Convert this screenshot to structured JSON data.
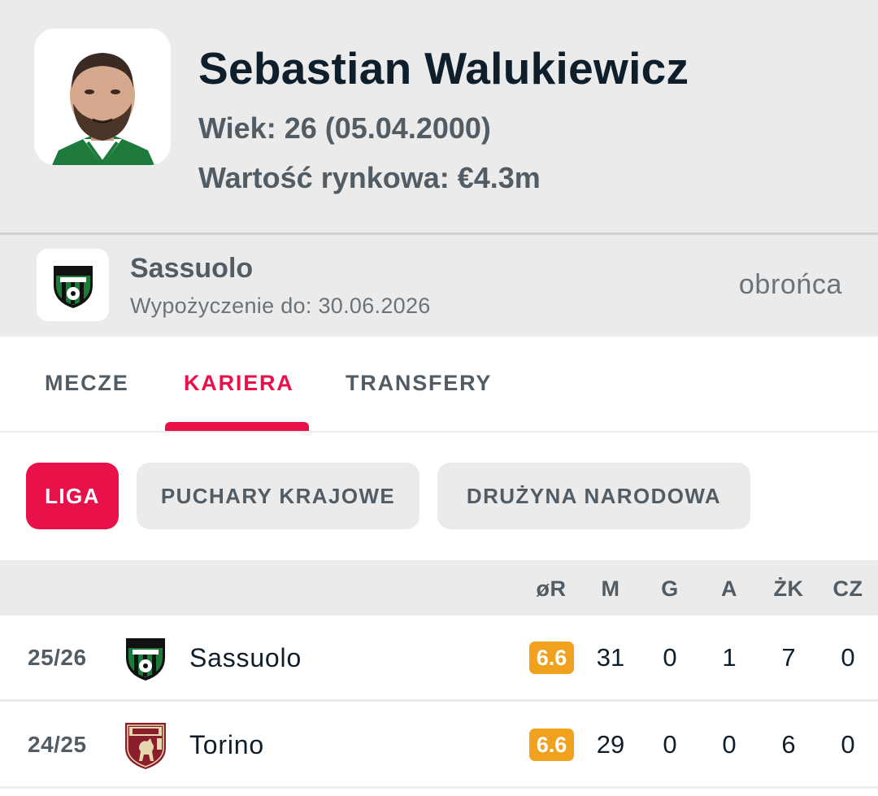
{
  "player": {
    "name": "Sebastian Walukiewicz",
    "age_line": "Wiek: 26 (05.04.2000)",
    "value_line": "Wartość rynkowa: €4.3m"
  },
  "club": {
    "name": "Sassuolo",
    "loan": "Wypożyczenie do: 30.06.2026",
    "position": "obrońca"
  },
  "tabs": [
    {
      "label": "MECZE",
      "active": false
    },
    {
      "label": "KARIERA",
      "active": true
    },
    {
      "label": "TRANSFERY",
      "active": false
    }
  ],
  "filters": [
    {
      "label": "LIGA",
      "active": true
    },
    {
      "label": "PUCHARY KRAJOWE",
      "active": false
    },
    {
      "label": "DRUŻYNA NARODOWA",
      "active": false
    }
  ],
  "table": {
    "headers": {
      "rating": "øR",
      "matches": "M",
      "goals": "G",
      "assists": "A",
      "yellow": "ŻK",
      "red": "CZ"
    },
    "rows": [
      {
        "season": "25/26",
        "team": "Sassuolo",
        "logo": "sassuolo-crest-icon",
        "rating": "6.6",
        "matches": "31",
        "goals": "0",
        "assists": "1",
        "yellow": "7",
        "red": "0"
      },
      {
        "season": "24/25",
        "team": "Torino",
        "logo": "torino-crest-icon",
        "rating": "6.6",
        "matches": "29",
        "goals": "0",
        "assists": "0",
        "yellow": "6",
        "red": "0"
      }
    ]
  },
  "colors": {
    "accent": "#e8114a",
    "rating_badge": "#f0a11d",
    "sassuolo_green": "#1c7a3a",
    "torino_maroon": "#8b1e2c"
  }
}
